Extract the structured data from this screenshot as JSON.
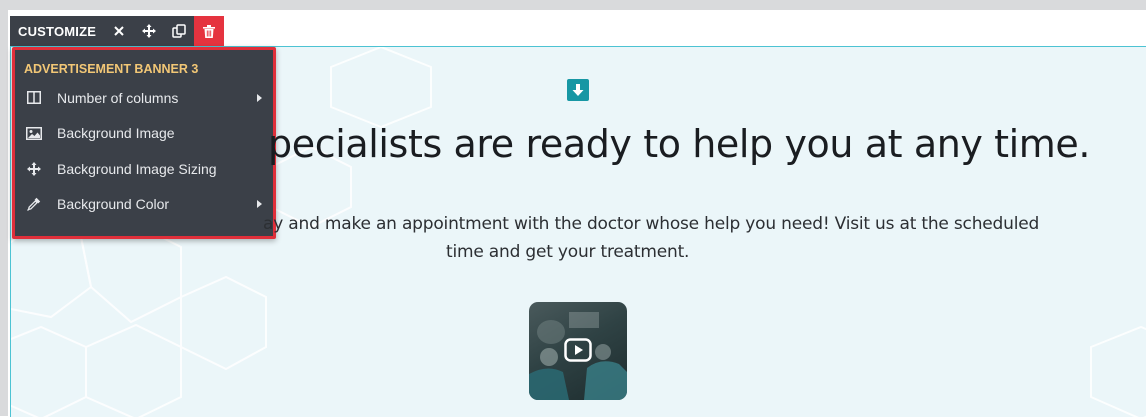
{
  "toolbar": {
    "label": "CUSTOMIZE",
    "icons": [
      "close-icon",
      "move-icon",
      "duplicate-icon",
      "trash-icon"
    ]
  },
  "menu": {
    "title": "ADVERTISEMENT BANNER 3",
    "items": [
      {
        "label": "Number of columns",
        "icon": "columns-icon",
        "has_submenu": true
      },
      {
        "label": "Background Image",
        "icon": "image-icon",
        "has_submenu": false
      },
      {
        "label": "Background Image Sizing",
        "icon": "move-arrows-icon",
        "has_submenu": false
      },
      {
        "label": "Background Color",
        "icon": "eyedropper-icon",
        "has_submenu": true
      }
    ]
  },
  "content": {
    "headline": "pecialists are ready to help you at any time.",
    "description_line1": "ay and make an appointment with the doctor whose help you need! Visit us at the scheduled",
    "description_line2": "time and get your treatment."
  },
  "colors": {
    "toolbar_bg": "#3b4048",
    "delete_red": "#e5333f",
    "menu_border": "#e02f3a",
    "menu_title": "#f2c776",
    "accent_teal": "#1797a4",
    "section_bg": "#ebf6f9"
  }
}
